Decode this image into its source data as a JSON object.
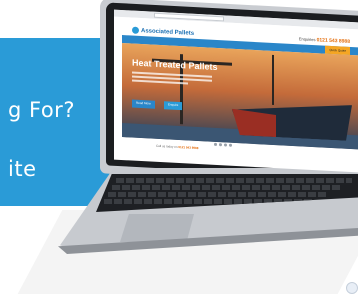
{
  "banner": {
    "line1": "g For?",
    "line2": "ite"
  },
  "site": {
    "logo": "Associated Pallets",
    "phone_label": "Enquiries",
    "phone_number": "0121 543 8988",
    "nav_items": [
      "Home",
      "Services",
      "Products",
      "Pallet Stock",
      "About Us",
      "Contact Us",
      "Blog"
    ],
    "nav_quote": "Quick Quote",
    "hero_title": "Heat Treated Pallets",
    "hero_button_1": "Read More",
    "hero_button_2": "Enquire",
    "footer_text": "Call us today on",
    "footer_highlight": "0121 543 8988"
  },
  "colors": {
    "banner_blue": "#2a9bd7",
    "nav_blue": "#2a86c9",
    "accent_orange": "#e46c0a"
  }
}
